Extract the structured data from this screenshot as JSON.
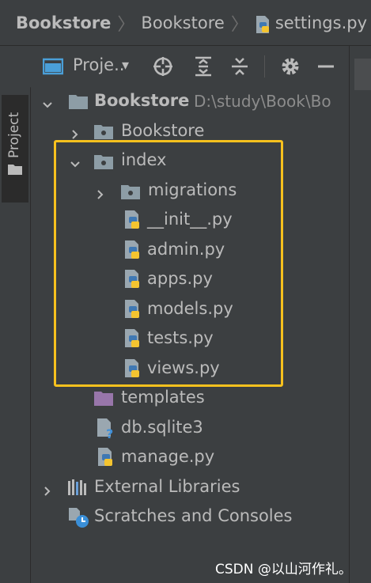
{
  "breadcrumb": {
    "items": [
      "Bookstore",
      "Bookstore",
      "settings.py"
    ],
    "separator": "〉"
  },
  "side_panel": {
    "label": "Project"
  },
  "toolbar": {
    "view_selector": "Proje..",
    "dropdown_arrow": "▾"
  },
  "tree": {
    "root": {
      "name": "Bookstore",
      "path": "D:\\study\\Book\\Bo"
    },
    "bookstore_folder": "Bookstore",
    "index_folder": "index",
    "migrations_folder": "migrations",
    "index_files": [
      "__init__.py",
      "admin.py",
      "apps.py",
      "models.py",
      "tests.py",
      "views.py"
    ],
    "templates_folder": "templates",
    "db_file": "db.sqlite3",
    "manage_file": "manage.py",
    "external_libraries": "External Libraries",
    "scratches": "Scratches and Consoles"
  },
  "watermark": "CSDN @以山河作礼。",
  "colors": {
    "background": "#3c3f41",
    "highlight_border": "#f7c11e",
    "text": "#bbbbbb",
    "path_text": "#8c8c8c",
    "folder": "#8d9da6",
    "templates_folder": "#9876aa",
    "python_blue": "#3f78b3",
    "python_yellow": "#f4c430"
  },
  "icons": {
    "folder": "folder-icon",
    "python_file": "python-file-icon",
    "database_file": "database-file-icon",
    "libraries": "libraries-icon",
    "scratches": "scratches-icon"
  }
}
